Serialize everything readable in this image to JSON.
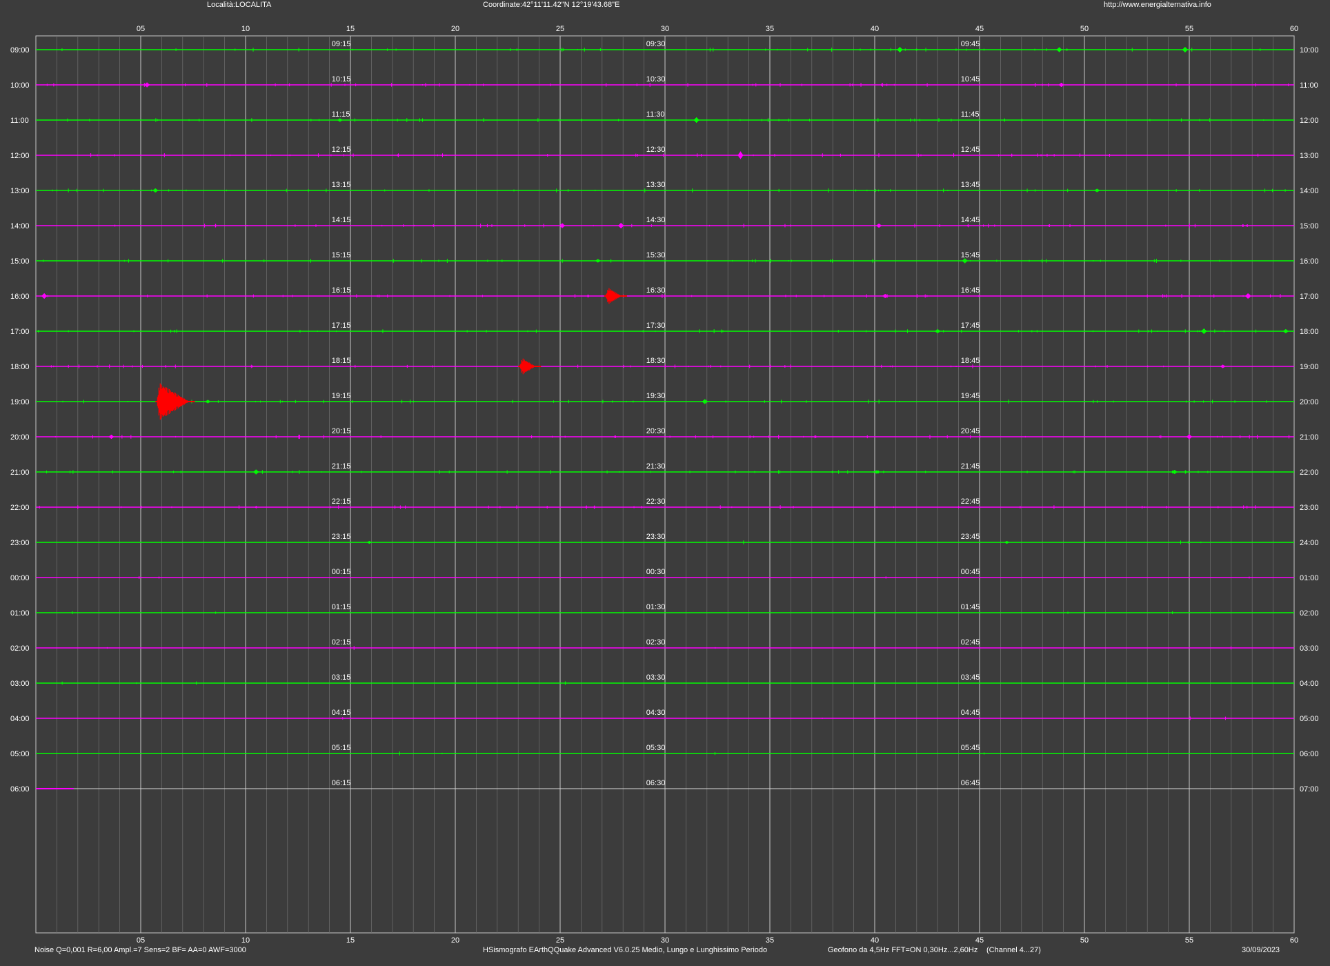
{
  "header": {
    "locality": "Località:LOCALITA",
    "coordinates": "Coordinate:42°11'11.42\"N  12°19'43.68\"E",
    "website": "http://www.energialternativa.info"
  },
  "footer": {
    "noise_params": "Noise Q=0,001 R=6,00 Ampl.=7 Sens=2 BF= AA=0 AWF=3000",
    "software": "HSismografo  EArthQQuake Advanced V6.0.25  Medio, Lungo e Lunghissimo Periodo",
    "sensor": "Geofono da 4,5Hz FFT=ON 0,30Hz...2,60Hz",
    "channel": "(Channel 4...27)",
    "date": "30/09/2023"
  },
  "colors": {
    "background": "#3c3c3c",
    "trace_odd": "#00ff00",
    "trace_even": "#ff00ff",
    "event": "#ff0000",
    "grid_major": "#c8c8c8",
    "grid_minor": "#707070"
  },
  "chart_data": {
    "type": "line",
    "title": "",
    "xlabel": "",
    "ylabel": "",
    "xlim": [
      0,
      60
    ],
    "x_unit": "minutes",
    "x_tick_labels": [
      "05",
      "10",
      "15",
      "20",
      "25",
      "30",
      "35",
      "40",
      "45",
      "50",
      "55",
      "60"
    ],
    "grid": true,
    "traces": [
      {
        "start": "09:00",
        "end": "10:00",
        "q1": "09:15",
        "q2": "09:30",
        "q3": "09:45"
      },
      {
        "start": "10:00",
        "end": "11:00",
        "q1": "10:15",
        "q2": "10:30",
        "q3": "10:45"
      },
      {
        "start": "11:00",
        "end": "12:00",
        "q1": "11:15",
        "q2": "11:30",
        "q3": "11:45"
      },
      {
        "start": "12:00",
        "end": "13:00",
        "q1": "12:15",
        "q2": "12:30",
        "q3": "12:45"
      },
      {
        "start": "13:00",
        "end": "14:00",
        "q1": "13:15",
        "q2": "13:30",
        "q3": "13:45"
      },
      {
        "start": "14:00",
        "end": "15:00",
        "q1": "14:15",
        "q2": "14:30",
        "q3": "14:45"
      },
      {
        "start": "15:00",
        "end": "16:00",
        "q1": "15:15",
        "q2": "15:30",
        "q3": "15:45"
      },
      {
        "start": "16:00",
        "end": "17:00",
        "q1": "16:15",
        "q2": "16:30",
        "q3": "16:45"
      },
      {
        "start": "17:00",
        "end": "18:00",
        "q1": "17:15",
        "q2": "17:30",
        "q3": "17:45"
      },
      {
        "start": "18:00",
        "end": "19:00",
        "q1": "18:15",
        "q2": "18:30",
        "q3": "18:45"
      },
      {
        "start": "19:00",
        "end": "20:00",
        "q1": "19:15",
        "q2": "19:30",
        "q3": "19:45"
      },
      {
        "start": "20:00",
        "end": "21:00",
        "q1": "20:15",
        "q2": "20:30",
        "q3": "20:45"
      },
      {
        "start": "21:00",
        "end": "22:00",
        "q1": "21:15",
        "q2": "21:30",
        "q3": "21:45"
      },
      {
        "start": "22:00",
        "end": "23:00",
        "q1": "22:15",
        "q2": "22:30",
        "q3": "22:45"
      },
      {
        "start": "23:00",
        "end": "24:00",
        "q1": "23:15",
        "q2": "23:30",
        "q3": "23:45"
      },
      {
        "start": "00:00",
        "end": "01:00",
        "q1": "00:15",
        "q2": "00:30",
        "q3": "00:45"
      },
      {
        "start": "01:00",
        "end": "02:00",
        "q1": "01:15",
        "q2": "01:30",
        "q3": "01:45"
      },
      {
        "start": "02:00",
        "end": "03:00",
        "q1": "02:15",
        "q2": "02:30",
        "q3": "02:45"
      },
      {
        "start": "03:00",
        "end": "04:00",
        "q1": "03:15",
        "q2": "03:30",
        "q3": "03:45"
      },
      {
        "start": "04:00",
        "end": "05:00",
        "q1": "04:15",
        "q2": "04:30",
        "q3": "04:45"
      },
      {
        "start": "05:00",
        "end": "06:00",
        "q1": "05:15",
        "q2": "05:30",
        "q3": "05:45"
      },
      {
        "start": "06:00",
        "end": "07:00",
        "q1": "06:15",
        "q2": "06:30",
        "q3": "06:45",
        "recorded_until_minute": 1.8
      }
    ],
    "events": [
      {
        "trace": "16:00",
        "minute": 27.3,
        "amplitude": 2.0
      },
      {
        "trace": "18:00",
        "minute": 23.2,
        "amplitude": 2.0
      },
      {
        "trace": "19:00",
        "minute": 5.9,
        "amplitude": 4.5
      }
    ],
    "spikes": [
      {
        "trace": "09:00",
        "minute": 41.2,
        "amplitude": 0.8
      },
      {
        "trace": "09:00",
        "minute": 48.8,
        "amplitude": 0.7
      },
      {
        "trace": "09:00",
        "minute": 54.8,
        "amplitude": 0.8
      },
      {
        "trace": "10:00",
        "minute": 5.3,
        "amplitude": 0.7
      },
      {
        "trace": "10:00",
        "minute": 48.9,
        "amplitude": 0.6
      },
      {
        "trace": "11:00",
        "minute": 31.5,
        "amplitude": 0.8
      },
      {
        "trace": "11:00",
        "minute": 14.5,
        "amplitude": 0.5
      },
      {
        "trace": "12:00",
        "minute": 33.6,
        "amplitude": 1.1
      },
      {
        "trace": "13:00",
        "minute": 5.7,
        "amplitude": 0.6
      },
      {
        "trace": "13:00",
        "minute": 50.6,
        "amplitude": 0.5
      },
      {
        "trace": "14:00",
        "minute": 25.1,
        "amplitude": 0.7
      },
      {
        "trace": "14:00",
        "minute": 27.9,
        "amplitude": 0.8
      },
      {
        "trace": "14:00",
        "minute": 40.2,
        "amplitude": 0.6
      },
      {
        "trace": "15:00",
        "minute": 44.3,
        "amplitude": 0.7
      },
      {
        "trace": "15:00",
        "minute": 26.8,
        "amplitude": 0.5
      },
      {
        "trace": "16:00",
        "minute": 0.4,
        "amplitude": 0.8
      },
      {
        "trace": "16:00",
        "minute": 40.5,
        "amplitude": 0.6
      },
      {
        "trace": "16:00",
        "minute": 57.8,
        "amplitude": 0.8
      },
      {
        "trace": "17:00",
        "minute": 43.0,
        "amplitude": 0.6
      },
      {
        "trace": "17:00",
        "minute": 55.7,
        "amplitude": 0.8
      },
      {
        "trace": "17:00",
        "minute": 59.6,
        "amplitude": 0.6
      },
      {
        "trace": "18:00",
        "minute": 56.6,
        "amplitude": 0.5
      },
      {
        "trace": "19:00",
        "minute": 31.9,
        "amplitude": 0.7
      },
      {
        "trace": "19:00",
        "minute": 8.2,
        "amplitude": 0.5
      },
      {
        "trace": "20:00",
        "minute": 3.6,
        "amplitude": 0.6
      },
      {
        "trace": "20:00",
        "minute": 55.0,
        "amplitude": 0.7
      },
      {
        "trace": "21:00",
        "minute": 10.5,
        "amplitude": 0.7
      },
      {
        "trace": "21:00",
        "minute": 54.3,
        "amplitude": 0.6
      },
      {
        "trace": "21:00",
        "minute": 40.1,
        "amplitude": 0.5
      },
      {
        "trace": "23:00",
        "minute": 15.9,
        "amplitude": 0.4
      },
      {
        "trace": "23:00",
        "minute": 46.3,
        "amplitude": 0.4
      }
    ]
  }
}
